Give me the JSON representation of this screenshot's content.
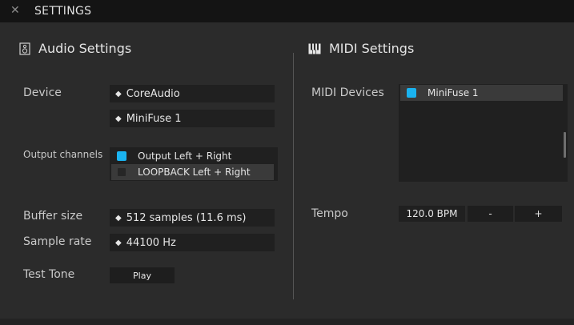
{
  "window": {
    "title": "SETTINGS"
  },
  "audio": {
    "section_title": "Audio Settings",
    "device_label": "Device",
    "device_driver": "CoreAudio",
    "device_name": "MiniFuse 1",
    "output_channels_label": "Output channels",
    "output_channels": [
      {
        "label": "Output Left + Right",
        "checked": true
      },
      {
        "label": "LOOPBACK Left + Right",
        "checked": false
      }
    ],
    "buffer_size_label": "Buffer size",
    "buffer_size_value": "512 samples (11.6 ms)",
    "sample_rate_label": "Sample rate",
    "sample_rate_value": "44100 Hz",
    "test_tone_label": "Test Tone",
    "play_label": "Play"
  },
  "midi": {
    "section_title": "MIDI Settings",
    "devices_label": "MIDI Devices",
    "devices": [
      {
        "label": "MiniFuse 1",
        "checked": true
      }
    ],
    "tempo_label": "Tempo",
    "tempo_value": "120.0 BPM",
    "minus_label": "-",
    "plus_label": "+"
  },
  "colors": {
    "accent": "#1ab3f0",
    "background": "#2b2b2b",
    "field": "#202020",
    "titlebar": "#141414"
  }
}
